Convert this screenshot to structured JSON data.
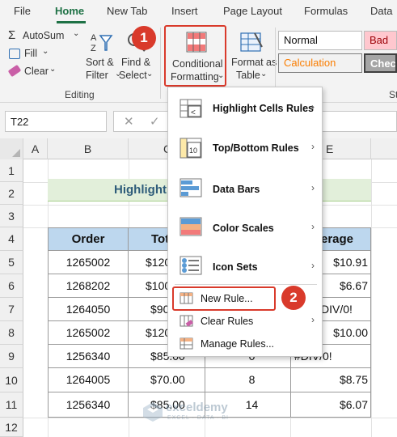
{
  "ribbon": {
    "tabs": [
      "File",
      "Home",
      "New Tab",
      "Insert",
      "Page Layout",
      "Formulas",
      "Data"
    ],
    "active_tab": "Home",
    "editing": {
      "autosum": "AutoSum",
      "fill": "Fill",
      "clear": "Clear",
      "sort_filter": [
        "Sort &",
        "Filter"
      ],
      "find_select": [
        "Find &",
        "Select"
      ],
      "group_label": "Editing"
    },
    "cond_format": [
      "Conditional",
      "Formatting"
    ],
    "format_table": [
      "Format as",
      "Table"
    ],
    "styles": {
      "normal": "Normal",
      "bad": "Bad",
      "calculation": "Calculation",
      "check": "Check",
      "group_label_partial": "St"
    }
  },
  "formula_bar": {
    "name_box": "T22"
  },
  "columns": [
    "A",
    "B",
    "C",
    "D",
    "E"
  ],
  "rows": [
    "1",
    "2",
    "3",
    "4",
    "5",
    "6",
    "7",
    "8",
    "9",
    "10",
    "11",
    "12"
  ],
  "sheet": {
    "title_visible": "Highlight",
    "headers": {
      "order": "Order",
      "total": "Tot",
      "average": "erage"
    },
    "orders": [
      "1265002",
      "1268202",
      "1264050",
      "1265002",
      "1256340",
      "1264005",
      "1256340"
    ],
    "totals": [
      "$120",
      "$100",
      "$90",
      "$120",
      "$85.00",
      "$70.00",
      "$85.00"
    ],
    "qty_visible": [
      "",
      "",
      "",
      "",
      "0",
      "8",
      "14"
    ],
    "averages": [
      "$10.91",
      "$6.67",
      "DIV/0!",
      "$10.00",
      "#DIV/0!",
      "$8.75",
      "$6.07"
    ]
  },
  "menu": {
    "items": [
      {
        "label": "Highlight Cells Rules",
        "submenu": true
      },
      {
        "label": "Top/Bottom Rules",
        "submenu": true
      },
      {
        "label": "Data Bars",
        "submenu": true
      },
      {
        "label": "Color Scales",
        "submenu": true
      },
      {
        "label": "Icon Sets",
        "submenu": true
      },
      {
        "label": "New Rule...",
        "submenu": false
      },
      {
        "label": "Clear Rules",
        "submenu": true
      },
      {
        "label": "Manage Rules...",
        "submenu": false
      }
    ]
  },
  "callouts": [
    "1",
    "2"
  ],
  "watermark": {
    "name": "exceldemy",
    "tagline": "EXCEL · DATA · BI"
  },
  "colors": {
    "accent": "#1e7145",
    "callout": "#d93a2b",
    "header_fill": "#bdd7ee",
    "title_fill": "#e2efda"
  }
}
